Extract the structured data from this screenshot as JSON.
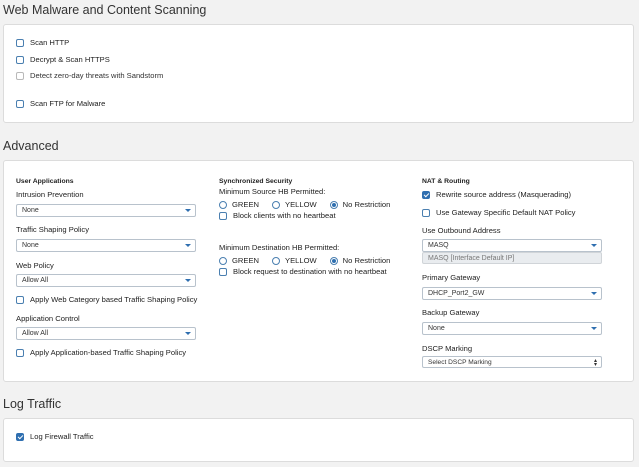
{
  "web_malware": {
    "title": "Web Malware and Content Scanning",
    "scan_http": "Scan HTTP",
    "decrypt_https": "Decrypt & Scan HTTPS",
    "zero_day": "Detect zero-day threats with Sandstorm",
    "scan_ftp": "Scan FTP for Malware"
  },
  "advanced": {
    "title": "Advanced",
    "user_apps": {
      "heading": "User Applications",
      "ips_label": "Intrusion Prevention",
      "ips_value": "None",
      "tsp_label": "Traffic Shaping Policy",
      "tsp_value": "None",
      "web_policy_label": "Web Policy",
      "web_policy_value": "Allow All",
      "web_cat_check": "Apply Web Category based Traffic Shaping Policy",
      "app_control_label": "Application Control",
      "app_control_value": "Allow All",
      "app_check": "Apply Application-based Traffic Shaping Policy"
    },
    "sync_security": {
      "heading": "Synchronized Security",
      "min_source_label": "Minimum Source HB Permitted:",
      "min_dest_label": "Minimum Destination HB Permitted:",
      "options": [
        "GREEN",
        "YELLOW",
        "No Restriction"
      ],
      "block_clients": "Block clients with no heartbeat",
      "block_dest": "Block request to destination with no heartbeat"
    },
    "nat": {
      "heading": "NAT & Routing",
      "rewrite": "Rewrite source address (Masquerading)",
      "gateway_nat": "Use Gateway Specific Default NAT Policy",
      "outbound_label": "Use Outbound Address",
      "outbound_value": "MASQ",
      "outbound_hint": "MASQ [Interface Default IP]",
      "primary_label": "Primary Gateway",
      "primary_value": "DHCP_Port2_GW",
      "backup_label": "Backup Gateway",
      "backup_value": "None",
      "dscp_label": "DSCP Marking",
      "dscp_value": "Select DSCP Marking"
    }
  },
  "log": {
    "title": "Log Traffic",
    "firewall": "Log Firewall Traffic"
  }
}
